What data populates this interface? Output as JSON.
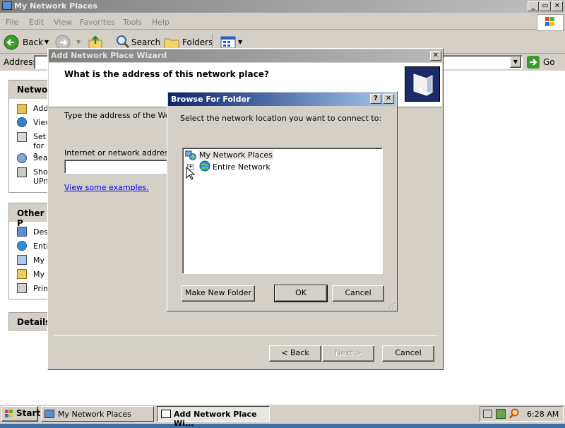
{
  "explorer": {
    "title": "My Network Places",
    "menu": [
      "File",
      "Edit",
      "View",
      "Favorites",
      "Tools",
      "Help"
    ],
    "toolbar": {
      "back": "Back",
      "search": "Search",
      "folders": "Folders"
    },
    "address_label": "Address",
    "go_label": "Go",
    "left_pane": {
      "network_tasks_header": "Networ",
      "network_tasks": [
        "Add",
        "Viev",
        "Set",
        "for a",
        "Sea",
        "Sho",
        "UPn"
      ],
      "other_places_header": "Other P",
      "other_places": [
        "Des",
        "Enti",
        "My (",
        "My I",
        "Prin"
      ],
      "details_header": "Details"
    }
  },
  "wizard": {
    "title": "Add Network Place Wizard",
    "heading": "What is the address of this network place?",
    "intro_text": "Type the address of the Web s",
    "address_label": "Internet or network address:",
    "address_value": "",
    "examples_link": "View some examples.",
    "back_button": "< Back",
    "next_button": "Next >",
    "cancel_button": "Cancel"
  },
  "browse_dialog": {
    "title": "Browse For Folder",
    "help_glyph": "?",
    "close_glyph": "✕",
    "instruction": "Select the network location you want to connect to:",
    "tree": {
      "root": "My Network Places",
      "children": [
        {
          "label": "Entire Network",
          "expander": "+"
        }
      ]
    },
    "make_new_folder_button": "Make New Folder",
    "ok_button": "OK",
    "cancel_button": "Cancel"
  },
  "taskbar": {
    "start_label": "Start",
    "tasks": [
      {
        "label": "My Network Places",
        "active": false
      },
      {
        "label": "Add Network Place Wi...",
        "active": true
      }
    ],
    "clock": "6:28 AM"
  }
}
